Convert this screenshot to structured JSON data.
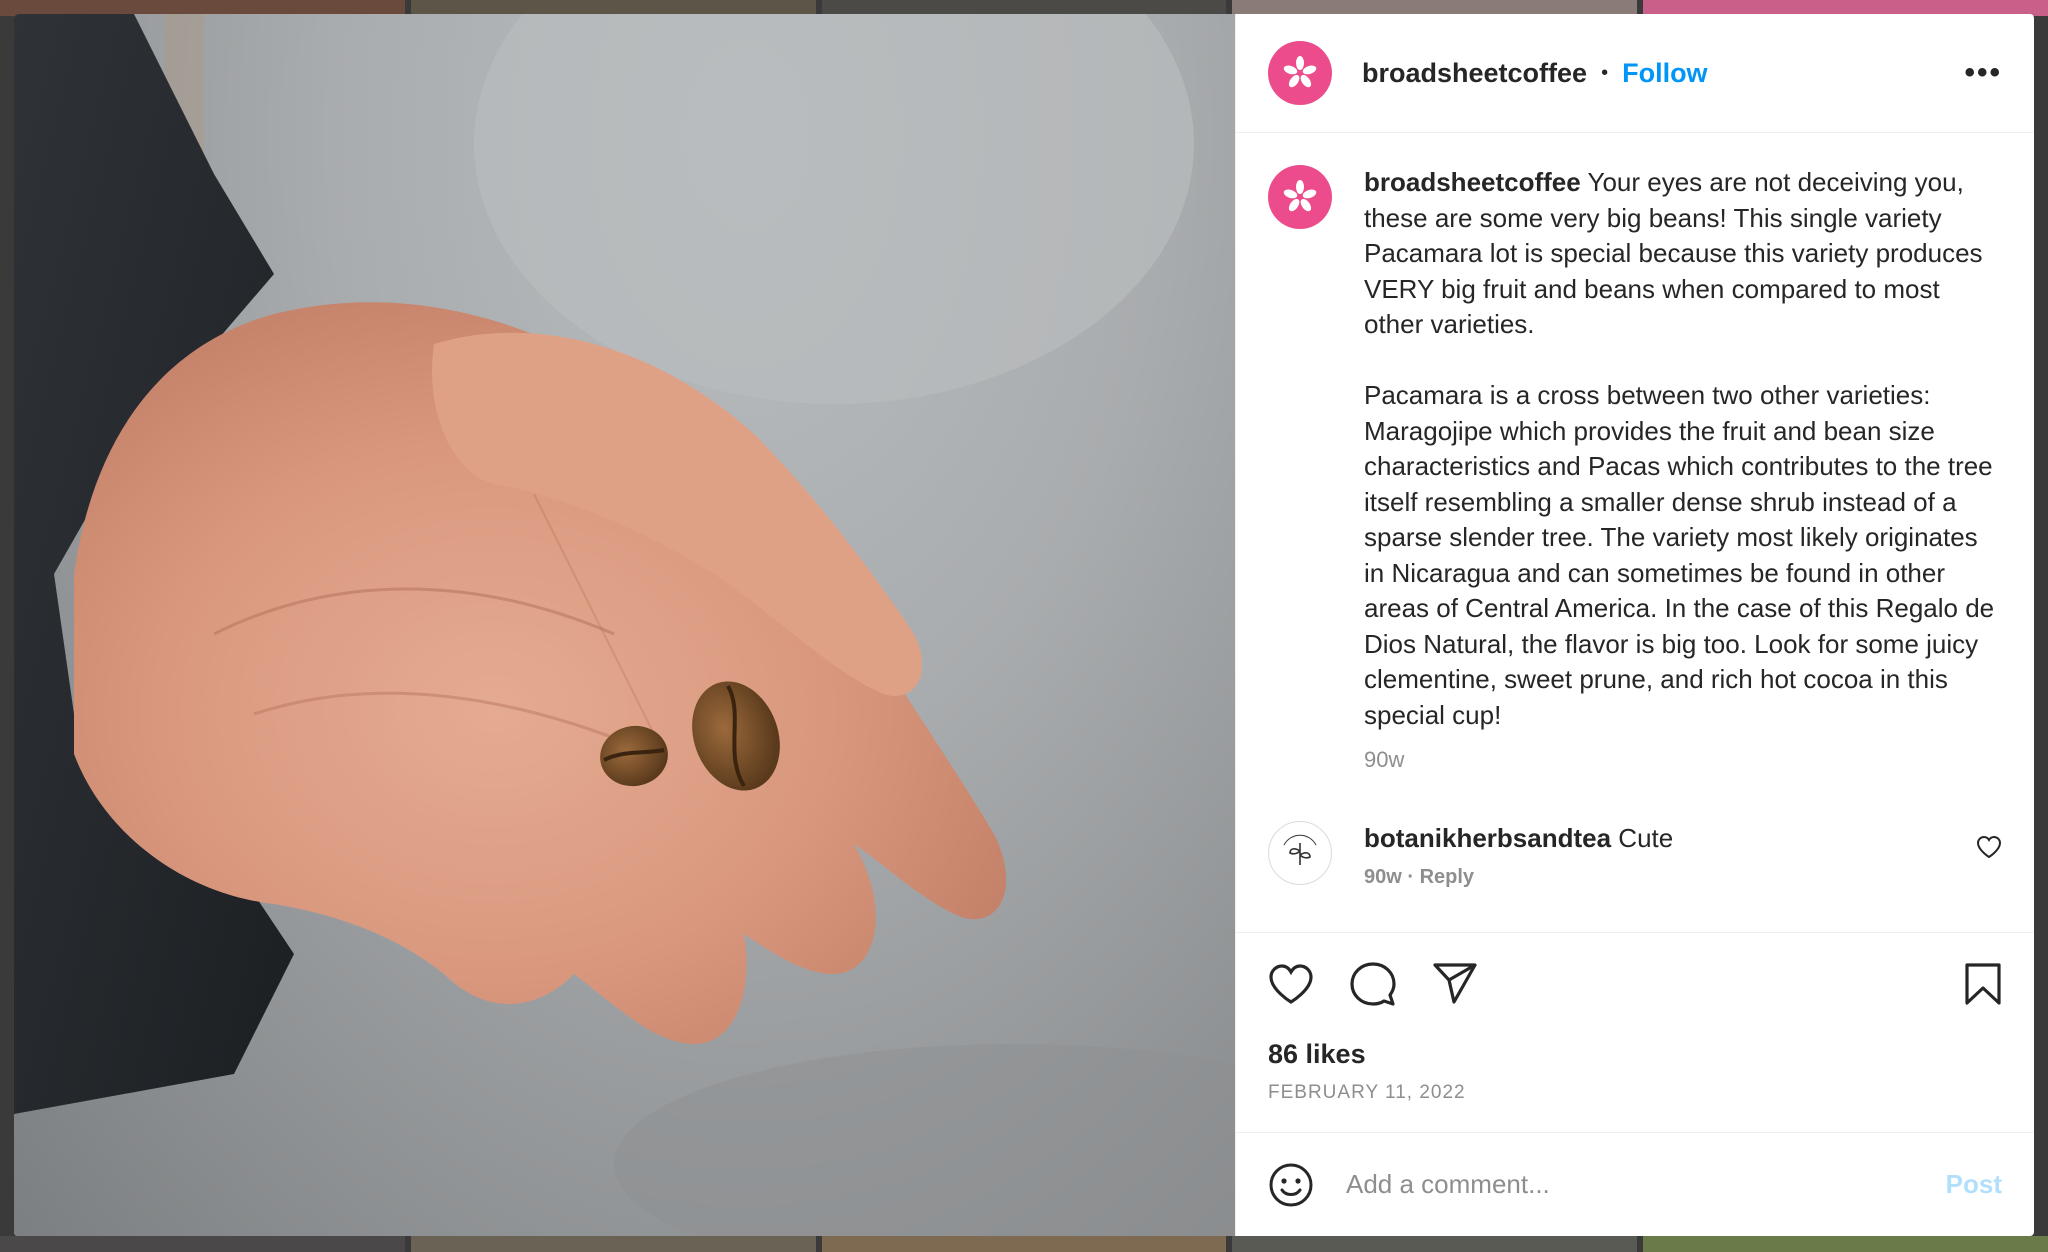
{
  "header": {
    "username": "broadsheetcoffee",
    "separator": "•",
    "follow_label": "Follow",
    "more_label": "•••"
  },
  "caption": {
    "username": "broadsheetcoffee",
    "paragraph1": "Your eyes are not deceiving you, these are some very big beans! This single variety Pacamara lot is special because this variety produces VERY big fruit and beans when compared to most other varieties.",
    "paragraph2": "Pacamara is a cross between two other varieties: Maragojipe which provides the fruit and bean size characteristics and Pacas which contributes to the tree itself resembling a smaller dense shrub instead of a sparse slender tree. The variety most likely originates in Nicaragua and can sometimes be found in other areas of Central America. In the case of this Regalo de Dios Natural, the flavor is big too. Look for some juicy clementine, sweet prune, and rich hot cocoa in this special cup!",
    "time": "90w"
  },
  "comments": [
    {
      "username": "botanikherbsandtea",
      "text": "Cute",
      "meta": "90w · Reply"
    }
  ],
  "stats": {
    "likes": "86 likes",
    "date": "FEBRUARY 11, 2022"
  },
  "composer": {
    "placeholder": "Add a comment...",
    "post_label": "Post"
  },
  "icons": [
    "flower-logo-icon",
    "more-options-icon",
    "heart-icon",
    "comment-icon",
    "share-icon",
    "bookmark-icon",
    "emoji-icon",
    "small-heart-icon"
  ],
  "colors": {
    "avatar_bg": "#ec4c8b",
    "follow_blue": "#0095f6",
    "post_disabled": "#b2dffc",
    "muted_text": "#8e8e8e"
  }
}
